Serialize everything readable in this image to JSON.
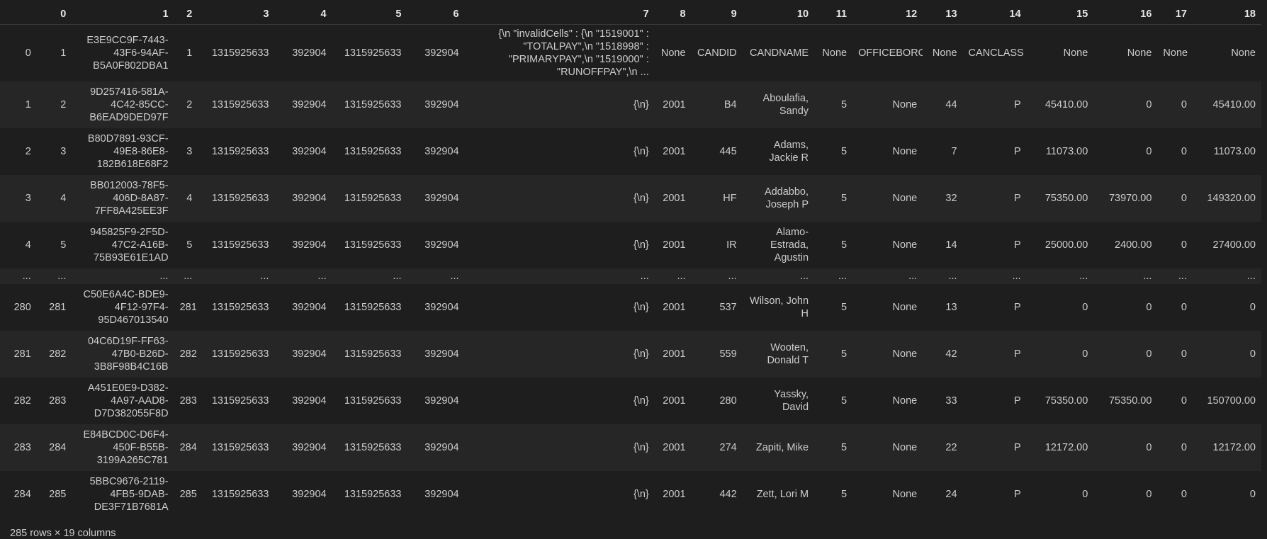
{
  "columns": [
    "",
    "0",
    "1",
    "2",
    "3",
    "4",
    "5",
    "6",
    "7",
    "8",
    "9",
    "10",
    "11",
    "12",
    "13",
    "14",
    "15",
    "16",
    "17",
    "18"
  ],
  "rows": [
    [
      "0",
      "1",
      "E3E9CC9F-7443-43F6-94AF-B5A0F802DBA1",
      "1",
      "1315925633",
      "392904",
      "1315925633",
      "392904",
      "{\\n \"invalidCells\" : {\\n \"1519001\" : \"TOTALPAY\",\\n \"1518998\" : \"PRIMARYPAY\",\\n \"1519000\" : \"RUNOFFPAY\",\\n ...",
      "None",
      "CANDID",
      "CANDNAME",
      "None",
      "OFFICEBORO",
      "None",
      "CANCLASS",
      "None",
      "None",
      "None",
      "None"
    ],
    [
      "1",
      "2",
      "9D257416-581A-4C42-85CC-B6EAD9DED97F",
      "2",
      "1315925633",
      "392904",
      "1315925633",
      "392904",
      "{\\n}",
      "2001",
      "B4",
      "Aboulafia, Sandy",
      "5",
      "None",
      "44",
      "P",
      "45410.00",
      "0",
      "0",
      "45410.00"
    ],
    [
      "2",
      "3",
      "B80D7891-93CF-49E8-86E8-182B618E68F2",
      "3",
      "1315925633",
      "392904",
      "1315925633",
      "392904",
      "{\\n}",
      "2001",
      "445",
      "Adams, Jackie R",
      "5",
      "None",
      "7",
      "P",
      "11073.00",
      "0",
      "0",
      "11073.00"
    ],
    [
      "3",
      "4",
      "BB012003-78F5-406D-8A87-7FF8A425EE3F",
      "4",
      "1315925633",
      "392904",
      "1315925633",
      "392904",
      "{\\n}",
      "2001",
      "HF",
      "Addabbo, Joseph P",
      "5",
      "None",
      "32",
      "P",
      "75350.00",
      "73970.00",
      "0",
      "149320.00"
    ],
    [
      "4",
      "5",
      "945825F9-2F5D-47C2-A16B-75B93E61E1AD",
      "5",
      "1315925633",
      "392904",
      "1315925633",
      "392904",
      "{\\n}",
      "2001",
      "IR",
      "Alamo-Estrada, Agustin",
      "5",
      "None",
      "14",
      "P",
      "25000.00",
      "2400.00",
      "0",
      "27400.00"
    ],
    [
      "...",
      "...",
      "...",
      "...",
      "...",
      "...",
      "...",
      "...",
      "...",
      "...",
      "...",
      "...",
      "...",
      "...",
      "...",
      "...",
      "...",
      "...",
      "...",
      "..."
    ],
    [
      "280",
      "281",
      "C50E6A4C-BDE9-4F12-97F4-95D467013540",
      "281",
      "1315925633",
      "392904",
      "1315925633",
      "392904",
      "{\\n}",
      "2001",
      "537",
      "Wilson, John H",
      "5",
      "None",
      "13",
      "P",
      "0",
      "0",
      "0",
      "0"
    ],
    [
      "281",
      "282",
      "04C6D19F-FF63-47B0-B26D-3B8F98B4C16B",
      "282",
      "1315925633",
      "392904",
      "1315925633",
      "392904",
      "{\\n}",
      "2001",
      "559",
      "Wooten, Donald T",
      "5",
      "None",
      "42",
      "P",
      "0",
      "0",
      "0",
      "0"
    ],
    [
      "282",
      "283",
      "A451E0E9-D382-4A97-AAD8-D7D382055F8D",
      "283",
      "1315925633",
      "392904",
      "1315925633",
      "392904",
      "{\\n}",
      "2001",
      "280",
      "Yassky, David",
      "5",
      "None",
      "33",
      "P",
      "75350.00",
      "75350.00",
      "0",
      "150700.00"
    ],
    [
      "283",
      "284",
      "E84BCD0C-D6F4-450F-B55B-3199A265C781",
      "284",
      "1315925633",
      "392904",
      "1315925633",
      "392904",
      "{\\n}",
      "2001",
      "274",
      "Zapiti, Mike",
      "5",
      "None",
      "22",
      "P",
      "12172.00",
      "0",
      "0",
      "12172.00"
    ],
    [
      "284",
      "285",
      "5BBC9676-2119-4FB5-9DAB-DE3F71B7681A",
      "285",
      "1315925633",
      "392904",
      "1315925633",
      "392904",
      "{\\n}",
      "2001",
      "442",
      "Zett, Lori M",
      "5",
      "None",
      "24",
      "P",
      "0",
      "0",
      "0",
      "0"
    ]
  ],
  "footer": "285 rows × 19 columns"
}
